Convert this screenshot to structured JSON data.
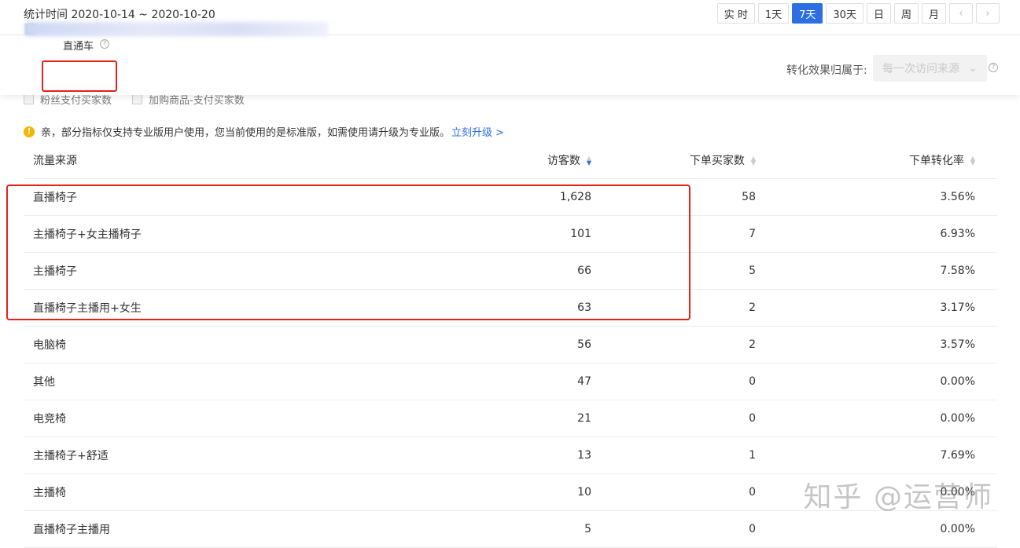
{
  "header": {
    "date_range": "统计时间 2020-10-14 ~ 2020-10-20",
    "periods": [
      "实 时",
      "1天",
      "7天",
      "30天",
      "日",
      "周",
      "月"
    ],
    "active_period": "7天",
    "prev_icon": "chevron-left-icon",
    "next_icon": "chevron-right-icon"
  },
  "panel": {
    "channel_label": "直通车",
    "attribution_label": "转化效果归属于:",
    "attribution_value": "每一次访问来源"
  },
  "partial_checkboxes": [
    "粉丝支付买家数",
    "加购商品-支付买家数"
  ],
  "notice": {
    "text": "亲，部分指标仅支持专业版用户使用，您当前使用的是标准版，如需使用请升级为专业版。",
    "link": "立刻升级 >"
  },
  "table": {
    "columns": [
      "流量来源",
      "访客数",
      "下单买家数",
      "下单转化率"
    ],
    "rows": [
      {
        "source": "直播椅子",
        "visitors": "1,628",
        "buyers": "58",
        "rate": "3.56%"
      },
      {
        "source": "主播椅子+女主播椅子",
        "visitors": "101",
        "buyers": "7",
        "rate": "6.93%"
      },
      {
        "source": "主播椅子",
        "visitors": "66",
        "buyers": "5",
        "rate": "7.58%"
      },
      {
        "source": "直播椅子主播用+女生",
        "visitors": "63",
        "buyers": "2",
        "rate": "3.17%"
      },
      {
        "source": "电脑椅",
        "visitors": "56",
        "buyers": "2",
        "rate": "3.57%"
      },
      {
        "source": "其他",
        "visitors": "47",
        "buyers": "0",
        "rate": "0.00%"
      },
      {
        "source": "电竞椅",
        "visitors": "21",
        "buyers": "0",
        "rate": "0.00%"
      },
      {
        "source": "主播椅子+舒适",
        "visitors": "13",
        "buyers": "1",
        "rate": "7.69%"
      },
      {
        "source": "主播椅",
        "visitors": "10",
        "buyers": "0",
        "rate": "0.00%"
      },
      {
        "source": "直播椅子主播用",
        "visitors": "5",
        "buyers": "0",
        "rate": "0.00%"
      }
    ]
  },
  "watermark": "知乎 @运营师",
  "colors": {
    "accent": "#2d6fe0",
    "highlight_box": "#e2231a",
    "warning": "#f5b500"
  }
}
